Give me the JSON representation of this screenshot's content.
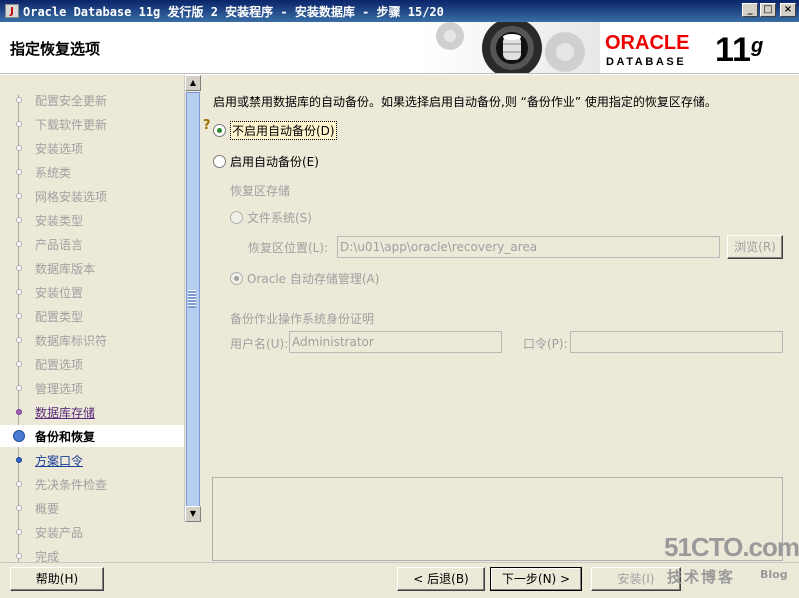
{
  "window": {
    "title": "Oracle Database 11g 发行版 2 安装程序 - 安装数据库 - 步骤 15/20",
    "minimize": "_",
    "maximize": "□",
    "close": "×"
  },
  "header": {
    "step_title": "指定恢复选项",
    "logo_oracle": "ORACLE",
    "logo_database": "DATABASE",
    "logo_version": "11",
    "logo_version_sup": "g"
  },
  "nav": {
    "items": [
      {
        "label": "配置安全更新",
        "state": "done"
      },
      {
        "label": "下载软件更新",
        "state": "done"
      },
      {
        "label": "安装选项",
        "state": "done"
      },
      {
        "label": "系统类",
        "state": "done"
      },
      {
        "label": "网格安装选项",
        "state": "done"
      },
      {
        "label": "安装类型",
        "state": "done"
      },
      {
        "label": "产品语言",
        "state": "done"
      },
      {
        "label": "数据库版本",
        "state": "done"
      },
      {
        "label": "安装位置",
        "state": "done"
      },
      {
        "label": "配置类型",
        "state": "done"
      },
      {
        "label": "数据库标识符",
        "state": "done"
      },
      {
        "label": "配置选项",
        "state": "done"
      },
      {
        "label": "管理选项",
        "state": "done"
      },
      {
        "label": "数据库存储",
        "state": "visited"
      },
      {
        "label": "备份和恢复",
        "state": "current"
      },
      {
        "label": "方案口令",
        "state": "next"
      },
      {
        "label": "先决条件检查",
        "state": "pending"
      },
      {
        "label": "概要",
        "state": "pending"
      },
      {
        "label": "安装产品",
        "state": "pending"
      },
      {
        "label": "完成",
        "state": "pending"
      }
    ]
  },
  "content": {
    "description": "启用或禁用数据库的自动备份。如果选择启用自动备份,则 “备份作业” 使用指定的恢复区存储。",
    "opt_disable": "不启用自动备份(D)",
    "opt_enable": "启用自动备份(E)",
    "recovery_storage_label": "恢复区存储",
    "opt_filesystem": "文件系统(S)",
    "recovery_location_label": "恢复区位置(L):",
    "recovery_location_value": "D:\\u01\\app\\oracle\\recovery_area",
    "browse_button": "浏览(R)",
    "opt_asm": "Oracle 自动存储管理(A)",
    "credentials_label": "备份作业操作系统身份证明",
    "username_label": "用户名(U):",
    "username_value": "Administrator",
    "password_label": "口令(P):",
    "password_value": ""
  },
  "buttons": {
    "help": "帮助(H)",
    "back": "< 后退(B)",
    "next": "下一步(N) >",
    "install": "安装(I)"
  },
  "watermark": {
    "site": "51CTO.com",
    "subtitle": "技术博客",
    "blog": "Blog"
  }
}
